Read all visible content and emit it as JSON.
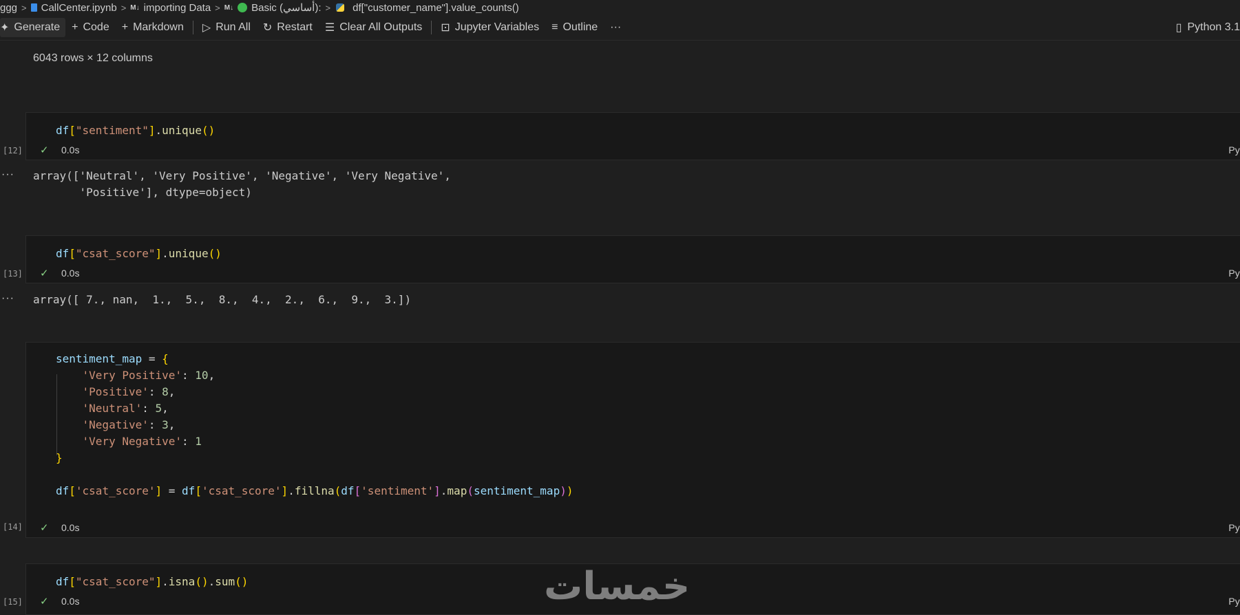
{
  "breadcrumb": {
    "items": [
      "ggg",
      "CallCenter.ipynb",
      "importing Data",
      "Basic (أساسي):",
      "df[\"customer_name\"].value_counts()"
    ],
    "icons": [
      "notebook-icon",
      "markdown-icon",
      "status-dot-icon",
      "python-icon"
    ],
    "md_label_1": "M↓",
    "md_label_2": "M↓"
  },
  "toolbar": {
    "generate": "Generate",
    "code": "Code",
    "markdown": "Markdown",
    "run_all": "Run All",
    "restart": "Restart",
    "clear_all": "Clear All Outputs",
    "jupyter_variables": "Jupyter Variables",
    "outline": "Outline",
    "more": "···",
    "kernel": "Python 3.1"
  },
  "df_output": "6043 rows × 12 columns",
  "cells": [
    {
      "count": "[12]",
      "time": "0.0s",
      "lang": "Python",
      "output_line1": "array(['Neutral', 'Very Positive', 'Negative', 'Very Negative',",
      "output_line2": "       'Positive'], dtype=object)"
    },
    {
      "count": "[13]",
      "time": "0.0s",
      "lang": "Python",
      "output_line1": "array([ 7., nan,  1.,  5.,  8.,  4.,  2.,  6.,  9.,  3.])"
    },
    {
      "count": "[14]",
      "time": "0.0s",
      "lang": "Python"
    },
    {
      "count": "[15]",
      "time": "0.0s",
      "lang": "Python"
    }
  ],
  "code": {
    "c12": {
      "var": "df",
      "key": "\"sentiment\"",
      "method": "unique"
    },
    "c13": {
      "var": "df",
      "key": "\"csat_score\"",
      "method": "unique"
    },
    "c14": {
      "map_var": "sentiment_map",
      "keys": [
        "'Very Positive'",
        "'Positive'",
        "'Neutral'",
        "'Negative'",
        "'Very Negative'"
      ],
      "vals": [
        "10",
        "8",
        "5",
        "3",
        "1"
      ],
      "df": "df",
      "col": "'csat_score'",
      "fillna": "fillna",
      "sentiment_col": "'sentiment'",
      "map": "map"
    },
    "c15": {
      "var": "df",
      "key": "\"csat_score\"",
      "m1": "isna",
      "m2": "sum"
    }
  },
  "watermark": "خمسات"
}
